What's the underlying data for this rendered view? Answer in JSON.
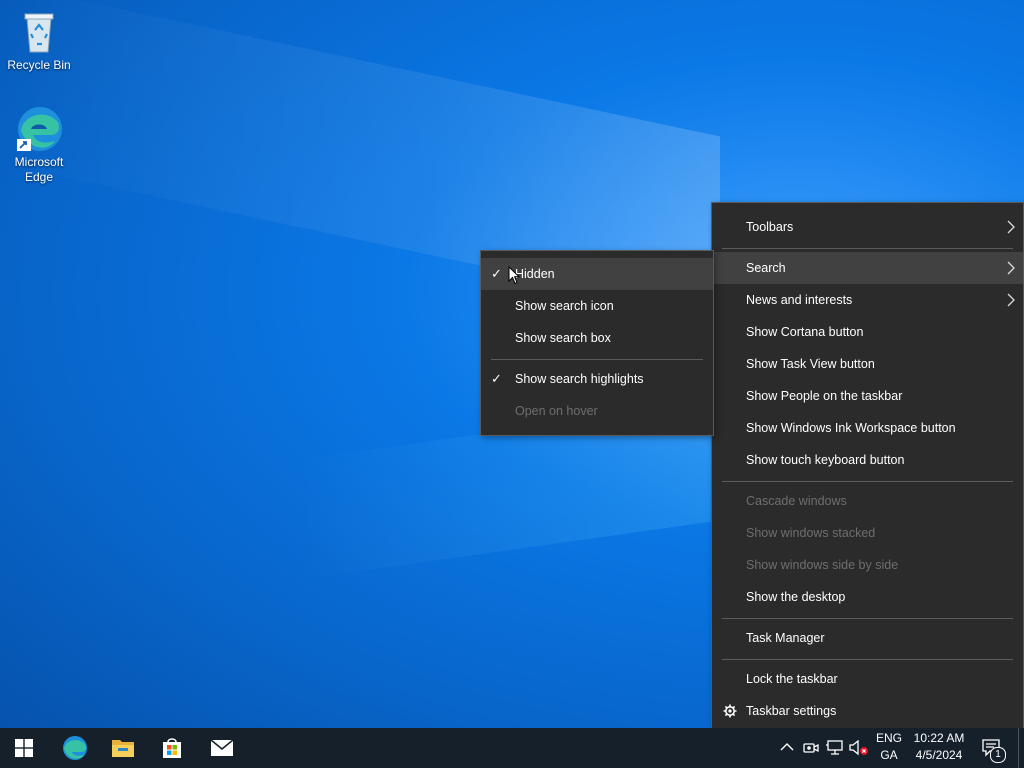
{
  "desktop": {
    "icons": [
      {
        "label": "Recycle Bin"
      },
      {
        "label": "Microsoft Edge"
      }
    ]
  },
  "context_menu": {
    "items": [
      {
        "label": "Toolbars",
        "submenu": true,
        "enabled": true
      },
      {
        "label": "Search",
        "submenu": true,
        "enabled": true,
        "highlighted": true
      },
      {
        "label": "News and interests",
        "submenu": true,
        "enabled": true
      },
      {
        "label": "Show Cortana button",
        "enabled": true
      },
      {
        "label": "Show Task View button",
        "enabled": true
      },
      {
        "label": "Show People on the taskbar",
        "enabled": true
      },
      {
        "label": "Show Windows Ink Workspace button",
        "enabled": true
      },
      {
        "label": "Show touch keyboard button",
        "enabled": true
      },
      {
        "label": "Cascade windows",
        "enabled": false
      },
      {
        "label": "Show windows stacked",
        "enabled": false
      },
      {
        "label": "Show windows side by side",
        "enabled": false
      },
      {
        "label": "Show the desktop",
        "enabled": true
      },
      {
        "label": "Task Manager",
        "enabled": true
      },
      {
        "label": "Lock the taskbar",
        "enabled": true
      },
      {
        "label": "Taskbar settings",
        "enabled": true,
        "icon": "gear-icon"
      }
    ]
  },
  "search_submenu": {
    "items": [
      {
        "label": "Hidden",
        "checked": true,
        "highlighted": true
      },
      {
        "label": "Show search icon",
        "checked": false
      },
      {
        "label": "Show search box",
        "checked": false
      },
      {
        "label": "Show search highlights",
        "checked": true
      },
      {
        "label": "Open on hover",
        "enabled": false
      }
    ],
    "check_glyph": "✓"
  },
  "taskbar": {
    "apps": [
      "start-icon",
      "edge-icon",
      "file-explorer-icon",
      "store-icon",
      "mail-icon"
    ],
    "tray": {
      "icons": [
        "chevron-up-icon",
        "meet-now-icon",
        "network-icon",
        "volume-muted-icon"
      ],
      "language_line1": "ENG",
      "language_line2": "GA",
      "time": "10:22 AM",
      "date": "4/5/2024",
      "notification_count": "1"
    }
  },
  "colors": {
    "menu_bg": "#2b2b2b",
    "menu_highlight": "#414141",
    "taskbar_bg": "#16202a",
    "disabled_text": "#6e6e6e"
  }
}
